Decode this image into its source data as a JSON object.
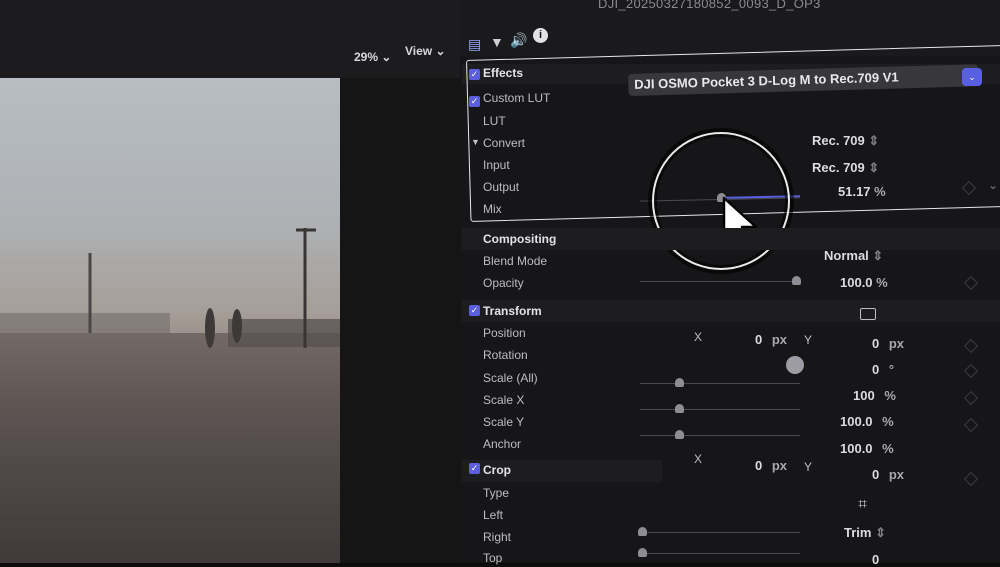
{
  "viewer": {
    "zoom": "29%",
    "view_label": "View"
  },
  "inspector": {
    "clip_name": "DJI_20250327180852_0093_D_OP3",
    "effects": {
      "title": "Effects",
      "custom_lut": {
        "title": "Custom LUT",
        "lut_label": "LUT",
        "lut_value": "DJI OSMO Pocket 3 D-Log M to Rec.709 V1",
        "convert_label": "Convert",
        "input_label": "Input",
        "input_value": "Rec. 709",
        "output_label": "Output",
        "output_value": "Rec. 709",
        "mix_label": "Mix",
        "mix_value": "51.17",
        "mix_unit": "%",
        "mix_fraction": 0.51
      }
    },
    "compositing": {
      "title": "Compositing",
      "blend_label": "Blend Mode",
      "blend_value": "Normal",
      "opacity_label": "Opacity",
      "opacity_value": "100.0",
      "opacity_unit": "%"
    },
    "transform": {
      "title": "Transform",
      "position_label": "Position",
      "x_label": "X",
      "position_x": "0",
      "y_label": "Y",
      "position_y": "0",
      "px": "px",
      "rotation_label": "Rotation",
      "rotation_value": "0",
      "deg": "°",
      "scale_all_label": "Scale (All)",
      "scale_all_value": "100",
      "scale_x_label": "Scale X",
      "scale_x_value": "100.0",
      "scale_y_label": "Scale Y",
      "scale_y_value": "100.0",
      "anchor_label": "Anchor",
      "anchor_x": "0",
      "anchor_y": "0",
      "pct": "%"
    },
    "crop": {
      "title": "Crop",
      "type_label": "Type",
      "type_value": "Trim",
      "left_label": "Left",
      "right_label": "Right",
      "top_label": "Top",
      "top_value": "0"
    }
  },
  "colors": {
    "accent": "#5a5fe0",
    "background": "#161618"
  }
}
